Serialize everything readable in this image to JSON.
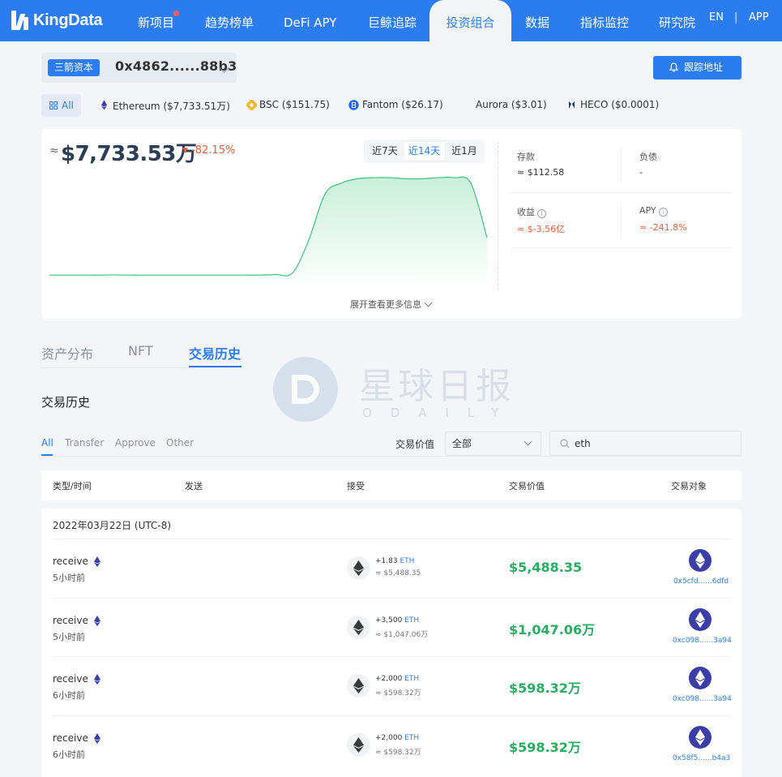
{
  "nav": {
    "logo": "KingData",
    "items": [
      {
        "label": "新项目"
      },
      {
        "label": "趋势榜单"
      },
      {
        "label": "DeFi APY"
      },
      {
        "label": "巨鲸追踪"
      },
      {
        "label": "投资组合"
      },
      {
        "label": "数据"
      },
      {
        "label": "指标监控"
      },
      {
        "label": "研究院"
      }
    ],
    "lang": "EN",
    "sep": "|",
    "app": "APP"
  },
  "address": {
    "tag": "三箭资本",
    "value": "0x4862......88b3",
    "track_label": "跟踪地址"
  },
  "chains": [
    {
      "label": "All"
    },
    {
      "label": "Ethereum ($7,733.51万)"
    },
    {
      "label": "BSC ($151.75)"
    },
    {
      "label": "Fantom ($26.17)"
    },
    {
      "label": "Aurora ($3.01)"
    },
    {
      "label": "HECO ($0.0001)"
    }
  ],
  "summary": {
    "approx": "≈",
    "total": "$7,733.53万",
    "change": "-82.15%",
    "ranges": [
      "近7天",
      "近14天",
      "近1月"
    ],
    "expand_label": "展开查看更多信息",
    "deposit_label": "存款",
    "deposit_value": "≈ $112.58",
    "debt_label": "负债",
    "debt_value": "-",
    "income_label": "收益",
    "income_value": "≈ $-3.56亿",
    "apy_label": "APY",
    "apy_value": "≈ -241.8%",
    "info_glyph": "i"
  },
  "chart_data": {
    "type": "area",
    "title": "",
    "xlabel": "",
    "ylabel": "",
    "range": "近14天",
    "x": [
      0,
      1,
      2,
      3,
      4,
      5,
      6,
      7,
      8,
      9,
      10,
      11,
      12,
      13,
      14,
      15,
      16,
      17,
      18,
      19,
      20,
      21,
      22,
      23,
      24,
      25,
      26,
      27
    ],
    "values": [
      8,
      8,
      8,
      8,
      8.2,
      8,
      8,
      8,
      8,
      8,
      8,
      8,
      8,
      8,
      8.5,
      10,
      40,
      82,
      92,
      96,
      97,
      97,
      96,
      96,
      97,
      97,
      92,
      42
    ],
    "ylim": [
      0,
      100
    ],
    "grid": false,
    "color": "#3cc47c"
  },
  "tabs": [
    {
      "label": "资产分布"
    },
    {
      "label": "NFT"
    },
    {
      "label": "交易历史"
    }
  ],
  "watermark": {
    "cn": "星球日报",
    "en": "ODAILY"
  },
  "history": {
    "title": "交易历史",
    "filters": [
      "All",
      "Transfer",
      "Approve",
      "Other"
    ],
    "value_label": "交易价值",
    "select_value": "全部",
    "search_value": "eth",
    "columns": [
      "类型/时间",
      "发送",
      "接受",
      "交易价值",
      "交易对象"
    ],
    "date": "2022年03月22日 (UTC-8)",
    "rows": [
      {
        "type": "receive",
        "time": "5小时前",
        "amount": "+1.83",
        "unit": "ETH",
        "amount_sub": "≈ $5,488.35",
        "value": "$5,488.35",
        "counterparty": "0x5cfd......6dfd"
      },
      {
        "type": "receive",
        "time": "5小时前",
        "amount": "+3,500",
        "unit": "ETH",
        "amount_sub": "≈ $1,047.06万",
        "value": "$1,047.06万",
        "counterparty": "0xc098......3a94"
      },
      {
        "type": "receive",
        "time": "6小时前",
        "amount": "+2,000",
        "unit": "ETH",
        "amount_sub": "≈ $598.32万",
        "value": "$598.32万",
        "counterparty": "0xc098......3a94"
      },
      {
        "type": "receive",
        "time": "6小时前",
        "amount": "+2,000",
        "unit": "ETH",
        "amount_sub": "≈ $598.32万",
        "value": "$598.32万",
        "counterparty": "0x58f5......b4a3"
      }
    ]
  },
  "colors": {
    "primary": "#2b7cf0",
    "positive": "#27ae60",
    "negative": "#ea5d3a"
  }
}
